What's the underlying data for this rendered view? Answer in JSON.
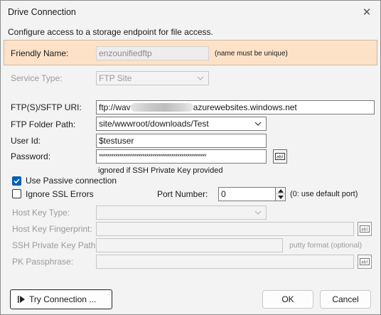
{
  "window": {
    "title": "Drive Connection"
  },
  "description": "Configure access to a storage endpoint for file access.",
  "friendly_name": {
    "label": "Friendly Name:",
    "value": "enzounifiedftp",
    "hint": "(name must be unique)"
  },
  "service_type": {
    "label": "Service Type:",
    "value": "FTP Site"
  },
  "ftp_uri": {
    "label": "FTP(S)/SFTP URI:",
    "value_prefix": "ftp://wav",
    "value_suffix": "azurewebsites.windows.net"
  },
  "ftp_folder_path": {
    "label": "FTP Folder Path:",
    "value": "site/wwwroot/downloads/Test"
  },
  "user_id": {
    "label": "User Id:",
    "value": "$testuser"
  },
  "password": {
    "label": "Password:",
    "value": "****************************************************",
    "note": "ignored if SSH Private Key provided"
  },
  "use_passive": {
    "label": "Use Passive connection",
    "checked": true
  },
  "ignore_ssl": {
    "label": "Ignore SSL Errors",
    "checked": false
  },
  "port": {
    "label": "Port Number:",
    "value": "0",
    "hint": "(0: use default port)"
  },
  "host_key_type": {
    "label": "Host Key Type:",
    "value": ""
  },
  "host_key_fingerprint": {
    "label": "Host Key Fingerprint:",
    "value": ""
  },
  "ssh_private_key_path": {
    "label": "SSH Private Key Path:",
    "value": "",
    "hint": "putty format (optional)"
  },
  "pk_passphrase": {
    "label": "PK Passphrase:",
    "value": ""
  },
  "buttons": {
    "try_connection": "Try Connection ...",
    "ok": "OK",
    "cancel": "Cancel"
  },
  "icons": {
    "close": "close-icon",
    "dropdown": "chevron-down-icon",
    "reveal": "text-field-icon",
    "play": "play-icon",
    "spin_up": "arrow-up-icon",
    "spin_down": "arrow-down-icon",
    "check": "check-icon"
  },
  "colors": {
    "accent": "#005fb8",
    "friendly_band": "#fde2c8",
    "window_bg": "#f3f3f3",
    "disabled_text": "#9a9a9a"
  }
}
